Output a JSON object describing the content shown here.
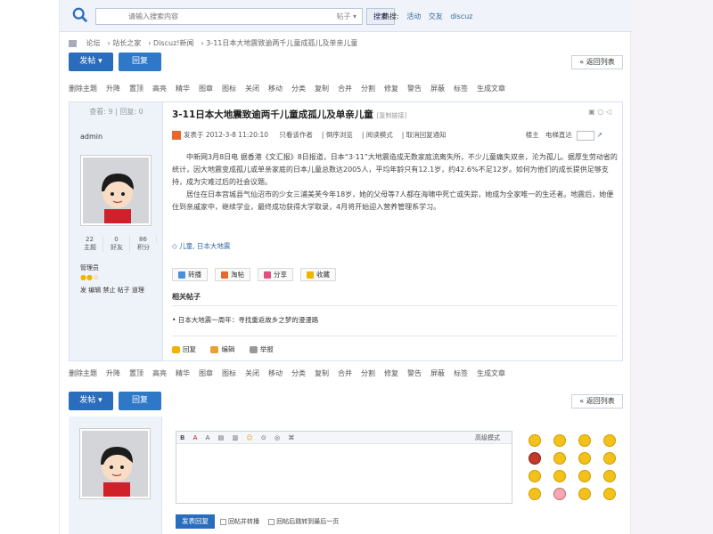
{
  "header": {
    "search_placeholder": "请输入搜索内容",
    "search_scope": "帖子 ▾",
    "search_button": "搜索",
    "hot_label": "热搜:",
    "hot_terms": [
      "活动",
      "交友",
      "discuz"
    ]
  },
  "breadcrumb": [
    "论坛",
    "站长之家",
    "Discuz!新闻",
    "3-11日本大地震致逾两千儿童成孤儿及单亲儿童"
  ],
  "buttons": {
    "post": "发帖 ▾",
    "reply": "回复",
    "back": "« 返回列表"
  },
  "modbar": [
    "删除主题",
    "升降",
    "置顶",
    "高亮",
    "精华",
    "图章",
    "图标",
    "关闭",
    "移动",
    "分类",
    "复制",
    "合并",
    "分割",
    "修复",
    "警告",
    "屏蔽",
    "标签",
    "生成文章"
  ],
  "post": {
    "side_stats": "查看: 9 | 回复: 0",
    "author": "admin",
    "counts": [
      {
        "value": "22",
        "label": "主题"
      },
      {
        "value": "0",
        "label": "好友"
      },
      {
        "value": "86",
        "label": "积分"
      }
    ],
    "group": "管理员",
    "admin_links": "发 编辑 禁止 帖子 道理",
    "title": "3-11日本大地震致逾两千儿童成孤儿及单亲儿童",
    "title_tag": "[复制链接]",
    "meta_parts": [
      "发表于 2012-3-8 11:20:10",
      "只看该作者",
      "倒序浏览",
      "阅读模式",
      "取消回复通知"
    ],
    "floor_label": "楼主",
    "floor_goto": "电梯直达",
    "body": [
      "中新网3月8日电 据香港《文汇报》8日报道，日本“3·11”大地震造成无数家庭流离失所，不少儿童痛失双亲，沦为孤儿。据厚生劳动省的统计，因大地震变成孤儿或单亲家庭的日本儿童总数达2005人，平均年龄只有12.1岁，约42.6%不足12岁。如何为他们的成长提供足够支持，成为灾难过后的社会议题。",
      "居住在日本宫城县气仙沼市的少女三浦美芙今年18岁，她的父母等7人都在海啸中死亡或失踪，她成为全家唯一的生还者。地震后，她便住到亲戚家中，继续学业，最终成功获得大学取录，4月将开始迎入营养管理系学习。"
    ],
    "tags": "儿童, 日本大地震",
    "share": [
      "转播",
      "淘帖",
      "分享",
      "收藏"
    ],
    "related_title": "相关帖子",
    "related_item": "• 日本大地震一周年：寻找重返故乡之梦的漫漫路",
    "actions": [
      "回复",
      "编辑",
      "举报"
    ]
  },
  "reply": {
    "toolbar": [
      "B",
      "A",
      "A",
      "▤",
      "▥",
      "☺",
      "⊙",
      "◎",
      "⌘"
    ],
    "mode": "高级模式",
    "submit": "发表回复",
    "options": [
      "回帖并转播",
      "回帖后跳转到最后一页"
    ]
  },
  "colors": {
    "accent": "#2a6dbd",
    "link": "#336699"
  }
}
